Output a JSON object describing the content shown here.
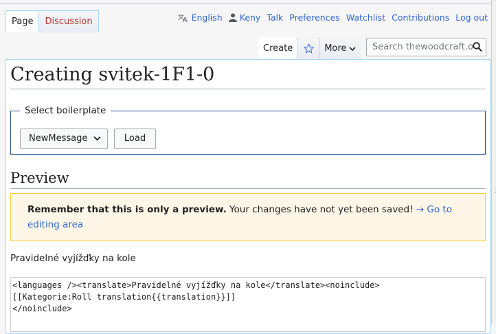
{
  "personal_tools": {
    "language": "English",
    "user": "Keny",
    "talk": "Talk",
    "preferences": "Preferences",
    "watchlist": "Watchlist",
    "contributions": "Contributions",
    "logout": "Log out"
  },
  "namespace_tabs": {
    "page": "Page",
    "discussion": "Discussion"
  },
  "view_tabs": {
    "create": "Create",
    "more": "More"
  },
  "search": {
    "placeholder": "Search thewoodcraft.org"
  },
  "page": {
    "title": "Creating svitek-1F1-0"
  },
  "boilerplate": {
    "legend": "Select boilerplate",
    "selected": "NewMessage",
    "load_button": "Load"
  },
  "preview": {
    "heading": "Preview",
    "warning_bold": "Remember that this is only a preview.",
    "warning_text": " Your changes have not yet been saved! ",
    "warning_link": "→ Go to editing area",
    "rendered_text": "Pravidelné vyjížďky na kole"
  },
  "editor": {
    "content": "<languages /><translate>Pravidelné vyjížďky na kole</translate><noinclude>\n[[Kategorie:Roll translation{{translation}}]]\n</noinclude>"
  },
  "colors": {
    "link": "#3366cc",
    "new_link": "#ba3b3b",
    "warning_bg": "#fef6e7",
    "warning_border": "#ffcc33"
  }
}
